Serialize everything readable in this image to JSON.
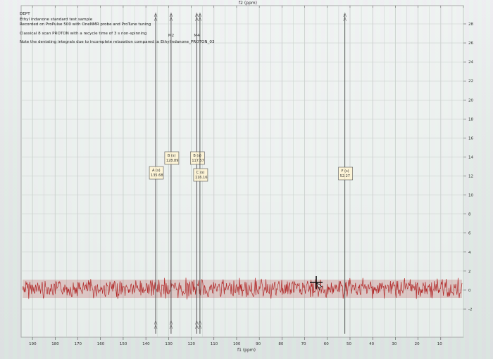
{
  "window": {
    "top_axis_label": "f2 (ppm)",
    "bottom_axis_label": "f1 (ppm)"
  },
  "spectrum_header": {
    "line1": "DEPT",
    "line2": "Ethyl indanone standard test sample",
    "line3": "Recorded on ProPulse 500 with OneNMR probe and ProTune tuning",
    "line4": "Classical 8 scan PROTON with a recycle time of 3 s non-spinning",
    "line5": "Note the deviating integrals due to incomplete relaxation compared to Ethylindanone_PROTON_03"
  },
  "bottom_axis": {
    "ticks": [
      "190",
      "180",
      "170",
      "160",
      "150",
      "140",
      "130",
      "120",
      "110",
      "100",
      "90",
      "80",
      "70",
      "60",
      "50",
      "40",
      "30",
      "20",
      "10"
    ]
  },
  "right_axis": {
    "ticks": [
      "28",
      "26",
      "24",
      "22",
      "20",
      "18",
      "16",
      "14",
      "12",
      "10",
      "8",
      "6",
      "4",
      "2",
      "0",
      "-2"
    ]
  },
  "peaks": [
    {
      "id": "A",
      "label": "A (s)",
      "value": "135.68",
      "ppm": 135.68
    },
    {
      "id": "B1",
      "label": "B (s)",
      "value": "128.89",
      "ppm": 128.89
    },
    {
      "id": "B2",
      "label": "B (s)",
      "value": "117.57",
      "ppm": 117.57
    },
    {
      "id": "C",
      "label": "C (s)",
      "value": "116.16",
      "ppm": 116.16
    },
    {
      "id": "F",
      "label": "F (s)",
      "value": "52.27",
      "ppm": 52.27
    }
  ],
  "multiplet_marks": [
    "M2",
    "M4"
  ],
  "colors": {
    "noise": "#b01818",
    "grid": "#c9cfcc",
    "peak_line": "#444444",
    "background": "#eef1ef"
  },
  "cursor": {
    "icon": "crosshair-cursor-icon"
  }
}
